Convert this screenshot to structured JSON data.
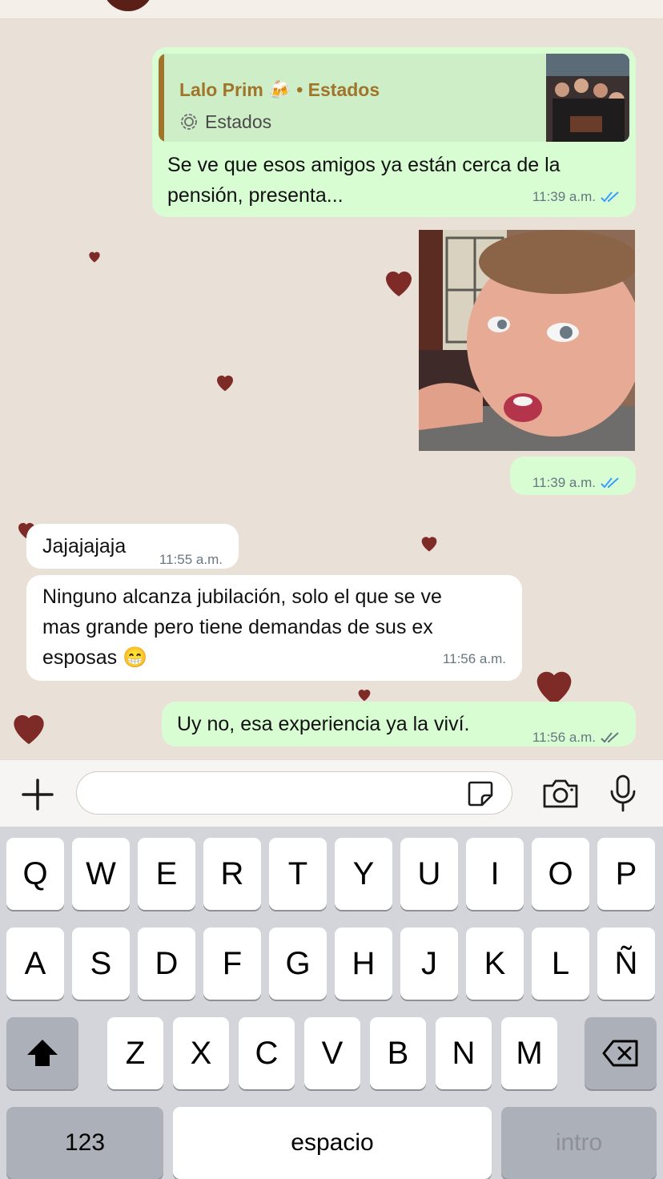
{
  "chat": {
    "messages": [
      {
        "quote_author": "Lalo Prim 🍻",
        "quote_source": "• Estados",
        "quote_sub": "Estados",
        "text_line1": "Se ve que esos amigos ya están cerca de la",
        "text_line2": "pensión, presenta...",
        "time": "11:39 a.m."
      },
      {
        "time": "11:39 a.m."
      },
      {
        "text": "Jajajajaja",
        "time": "11:55 a.m."
      },
      {
        "text_line1": "Ninguno alcanza jubilación, solo el que se ve",
        "text_line2": "mas grande pero tiene demandas de sus ex",
        "text_line3": "esposas 😁",
        "time": "11:56 a.m."
      },
      {
        "text": "Uy no, esa experiencia ya la viví.",
        "time": "11:56 a.m."
      }
    ]
  },
  "composer": {
    "placeholder": ""
  },
  "keyboard": {
    "row1": [
      "Q",
      "W",
      "E",
      "R",
      "T",
      "Y",
      "U",
      "I",
      "O",
      "P"
    ],
    "row2": [
      "A",
      "S",
      "D",
      "F",
      "G",
      "H",
      "J",
      "K",
      "L",
      "Ñ"
    ],
    "row3": [
      "Z",
      "X",
      "C",
      "V",
      "B",
      "N",
      "M"
    ],
    "numbers_label": "123",
    "space_label": "espacio",
    "return_label": "intro"
  },
  "colors": {
    "outgoing": "#d9fdd3",
    "incoming": "#ffffff",
    "read_tick": "#3b9cff",
    "quote_accent": "#a0752b"
  }
}
